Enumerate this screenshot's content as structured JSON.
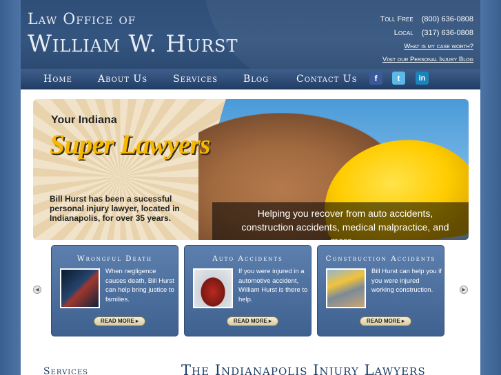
{
  "header": {
    "logo_line1": "Law Office of",
    "logo_line2": "William W. Hurst",
    "toll_free_label": "Toll Free",
    "toll_free_number": "(800) 636-0808",
    "local_label": "Local",
    "local_number": "(317) 636-0808",
    "case_worth_link": "What is my case worth?",
    "blog_link": "Visit our Personal Injury Blog"
  },
  "nav": {
    "items": [
      "Home",
      "About Us",
      "Services",
      "Blog",
      "Contact Us"
    ],
    "social": [
      "f",
      "t",
      "in"
    ]
  },
  "hero": {
    "your_indiana": "Your Indiana",
    "super_lawyers": "Super Lawyers",
    "blurb": "Bill Hurst has been a sucessful personal injury lawyer, located in Indianapolis, for over 35 years.",
    "caption": "Helping you recover from auto accidents, construction accidents, medical malpractice, and more..."
  },
  "cards": [
    {
      "title": "Wrongful Death",
      "text": "When negligence causes death, Bill Hurst can help bring justice to families.",
      "button": "READ MORE ▸"
    },
    {
      "title": "Auto Accidents",
      "text": "If you were injured in a automotive accident, William Hurst is there to help.",
      "button": "READ MORE ▸"
    },
    {
      "title": "Construction Accidents",
      "text": "Bill Hurst can help you if you were injured working construction.",
      "button": "READ MORE ▸"
    }
  ],
  "bottom": {
    "services_heading": "Services",
    "main_heading": "The Indianapolis Injury Lawyers"
  },
  "colors": {
    "header_bg": "#2f4f79",
    "nav_text": "#ffffff",
    "accent_gold": "#f6b900",
    "card_bg": "#4f72a2",
    "heading": "#1f3c63"
  }
}
